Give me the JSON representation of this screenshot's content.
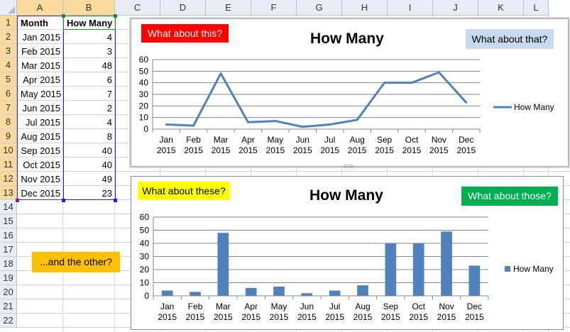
{
  "sheet": {
    "columns": [
      "A",
      "B",
      "C",
      "D",
      "E",
      "F",
      "G",
      "H",
      "I",
      "J",
      "K",
      "L"
    ],
    "rows": [
      "1",
      "2",
      "3",
      "4",
      "5",
      "6",
      "7",
      "8",
      "9",
      "10",
      "11",
      "12",
      "13",
      "14",
      "15",
      "16",
      "17",
      "18",
      "19",
      "20",
      "21",
      "22"
    ],
    "headers": {
      "month": "Month",
      "how_many": "How Many"
    },
    "table": [
      {
        "month": "Jan 2015",
        "value": "4"
      },
      {
        "month": "Feb 2015",
        "value": "3"
      },
      {
        "month": "Mar 2015",
        "value": "48"
      },
      {
        "month": "Apr 2015",
        "value": "6"
      },
      {
        "month": "May 2015",
        "value": "7"
      },
      {
        "month": "Jun 2015",
        "value": "2"
      },
      {
        "month": "Jul 2015",
        "value": "4"
      },
      {
        "month": "Aug 2015",
        "value": "8"
      },
      {
        "month": "Sep 2015",
        "value": "40"
      },
      {
        "month": "Oct 2015",
        "value": "40"
      },
      {
        "month": "Nov 2015",
        "value": "49"
      },
      {
        "month": "Dec 2015",
        "value": "23"
      }
    ]
  },
  "shapes": {
    "this": "What about this?",
    "that": "What about that?",
    "these": "What about these?",
    "those": "What about those?",
    "other": "...and the other?"
  },
  "colors": {
    "series": "#4f81bd",
    "red": "#ff0000",
    "light_blue": "#c6d9f1",
    "yellow": "#ffff00",
    "green": "#00b050",
    "orange": "#ffc000",
    "selection_green": "#228b22",
    "selection_blue": "#1a1aff",
    "selection_purple": "#8b1a8b"
  },
  "chart_data": [
    {
      "type": "line",
      "title": "How Many",
      "categories": [
        [
          "Jan",
          "2015"
        ],
        [
          "Feb",
          "2015"
        ],
        [
          "Mar",
          "2015"
        ],
        [
          "Apr",
          "2015"
        ],
        [
          "May",
          "2015"
        ],
        [
          "Jun",
          "2015"
        ],
        [
          "Jul",
          "2015"
        ],
        [
          "Aug",
          "2015"
        ],
        [
          "Sep",
          "2015"
        ],
        [
          "Oct",
          "2015"
        ],
        [
          "Nov",
          "2015"
        ],
        [
          "Dec",
          "2015"
        ]
      ],
      "series": [
        {
          "name": "How Many",
          "values": [
            4,
            3,
            48,
            6,
            7,
            2,
            4,
            8,
            40,
            40,
            49,
            23
          ]
        }
      ],
      "ylim": [
        0,
        60
      ],
      "yticks": [
        0,
        10,
        20,
        30,
        40,
        50,
        60
      ],
      "grid": true,
      "legend": "right"
    },
    {
      "type": "bar",
      "title": "How Many",
      "categories": [
        [
          "Jan",
          "2015"
        ],
        [
          "Feb",
          "2015"
        ],
        [
          "Mar",
          "2015"
        ],
        [
          "Apr",
          "2015"
        ],
        [
          "May",
          "2015"
        ],
        [
          "Jun",
          "2015"
        ],
        [
          "Jul",
          "2015"
        ],
        [
          "Aug",
          "2015"
        ],
        [
          "Sep",
          "2015"
        ],
        [
          "Oct",
          "2015"
        ],
        [
          "Nov",
          "2015"
        ],
        [
          "Dec",
          "2015"
        ]
      ],
      "series": [
        {
          "name": "How Many",
          "values": [
            4,
            3,
            48,
            6,
            7,
            2,
            4,
            8,
            40,
            40,
            49,
            23
          ]
        }
      ],
      "ylim": [
        0,
        60
      ],
      "yticks": [
        0,
        10,
        20,
        30,
        40,
        50,
        60
      ],
      "grid": true,
      "legend": "right"
    }
  ]
}
